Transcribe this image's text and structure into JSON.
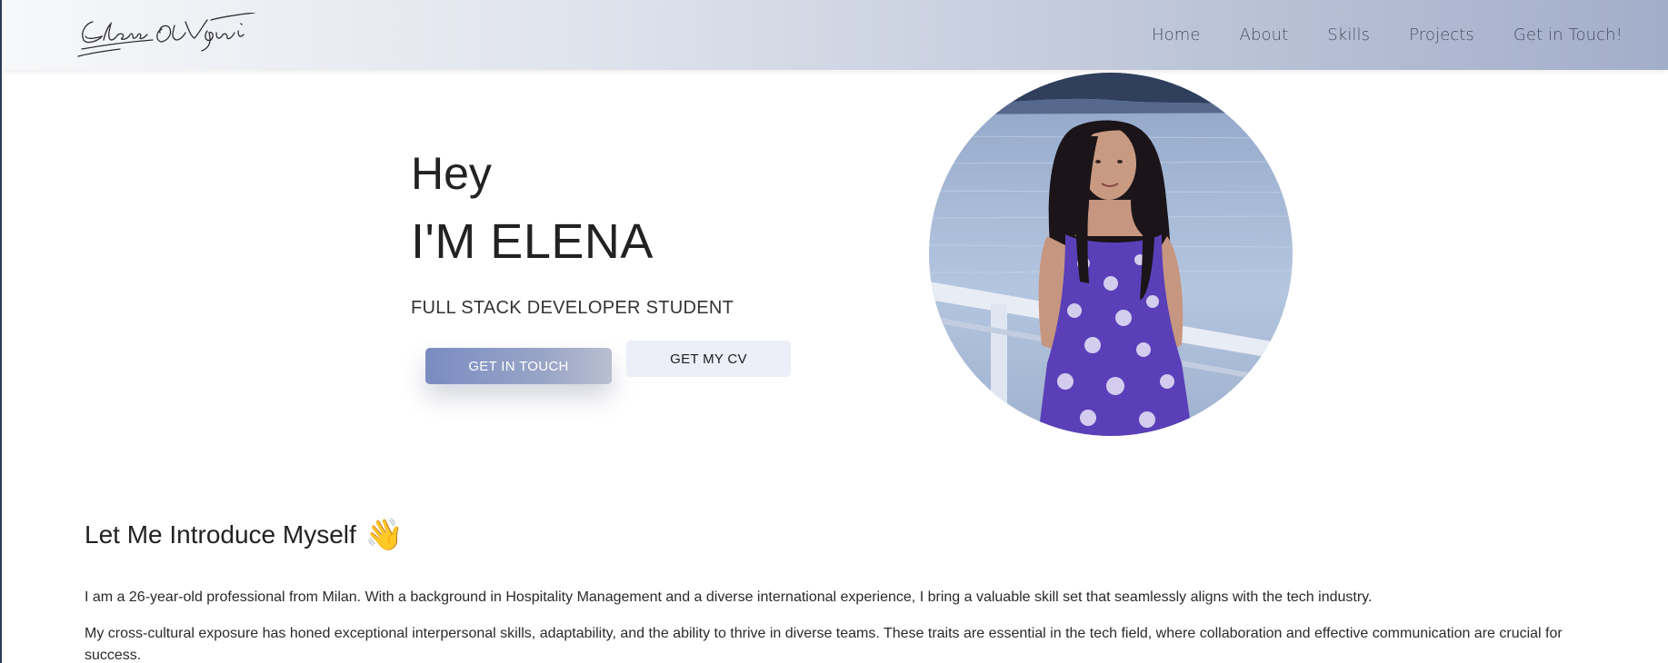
{
  "header": {
    "logo_text": "Elena Li Vigni",
    "nav": [
      {
        "label": "Home"
      },
      {
        "label": "About"
      },
      {
        "label": "Skills"
      },
      {
        "label": "Projects"
      },
      {
        "label": "Get in Touch!"
      }
    ]
  },
  "hero": {
    "greeting": "Hey",
    "name": "I'M ELENA",
    "role": "FULL STACK DEVELOPER STUDENT",
    "primary_button": "GET IN TOUCH",
    "secondary_button": "GET MY CV"
  },
  "intro": {
    "title": "Let Me Introduce Myself",
    "emoji": "👋",
    "paragraph_1": "I am a 26-year-old professional from Milan. With a background in Hospitality Management and a diverse international experience, I bring a valuable skill set that seamlessly aligns with the tech industry.",
    "paragraph_2": "My cross-cultural exposure has honed exceptional interpersonal skills, adaptability, and the ability to thrive in diverse teams. These traits are essential in the tech field, where collaboration and effective communication are crucial for success."
  },
  "colors": {
    "accent": "#7a8bc1",
    "nav_text": "#474f62",
    "cv_button_bg": "#eceef8"
  }
}
